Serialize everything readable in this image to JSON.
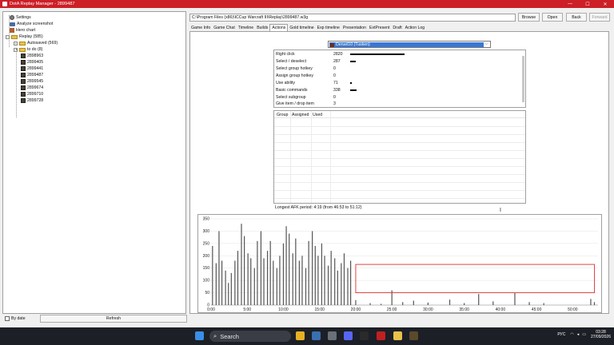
{
  "window": {
    "title": "DotA Replay Manager - 2899487",
    "minimize": "—",
    "maximize": "☐",
    "close": "✕"
  },
  "sidebar": {
    "items": [
      {
        "label": "Settings",
        "icon": "gear-icon"
      },
      {
        "label": "Analyze screenshot",
        "icon": "camera-icon"
      },
      {
        "label": "Hero chart",
        "icon": "hero-icon"
      },
      {
        "label": "Replay (585)",
        "icon": "folder-icon"
      },
      {
        "label": "Autosaved (569)",
        "icon": "folder-icon"
      },
      {
        "label": "to do (8)",
        "icon": "folder-icon"
      },
      {
        "label": "2898963",
        "icon": "replay-icon"
      },
      {
        "label": "2899405",
        "icon": "replay-icon"
      },
      {
        "label": "2899441",
        "icon": "replay-icon"
      },
      {
        "label": "2899487",
        "icon": "replay-icon"
      },
      {
        "label": "2899545",
        "icon": "replay-icon"
      },
      {
        "label": "2899674",
        "icon": "replay-icon"
      },
      {
        "label": "2899710",
        "icon": "replay-icon"
      },
      {
        "label": "2899728",
        "icon": "replay-icon"
      }
    ],
    "by_date": "By date",
    "refresh": "Refresh"
  },
  "path": {
    "value": "C:\\Program Files (x86)\\ICCup Warcraft III\\Replay\\2899487.w3g"
  },
  "toolbar": {
    "browse": "Browse",
    "open": "Open",
    "back": "Back",
    "forward": "Forward"
  },
  "tabs": [
    "Game Info",
    "Game Chat",
    "Timeline",
    "Builds",
    "Actions",
    "Gold timeline",
    "Exp timeline",
    "Presentation",
    "ExtPresent",
    "Draft",
    "Action Log"
  ],
  "active_tab": "Actions",
  "player": {
    "selected": "Deruel10 (Tusken)"
  },
  "actions": [
    {
      "name": "Right click",
      "value": "2820",
      "fraction": 1.0
    },
    {
      "name": "Select / deselect",
      "value": "287",
      "fraction": 0.1
    },
    {
      "name": "Select group hotkey",
      "value": "0",
      "fraction": 0
    },
    {
      "name": "Assign group hotkey",
      "value": "0",
      "fraction": 0
    },
    {
      "name": "Use ability",
      "value": "71",
      "fraction": 0.025
    },
    {
      "name": "Basic commands",
      "value": "338",
      "fraction": 0.12
    },
    {
      "name": "Select subgroup",
      "value": "0",
      "fraction": 0
    },
    {
      "name": "Give item / drop item",
      "value": "3",
      "fraction": 0
    }
  ],
  "groups": {
    "col_group": "Group",
    "col_assigned": "Assigned",
    "col_used": "Used"
  },
  "afk_text": "Longest AFK period: 4:19 (from 46:53 to 51:12)",
  "chart_data": {
    "type": "bar",
    "ylim": [
      0,
      350
    ],
    "yticks": [
      "350",
      "300",
      "250",
      "200",
      "150",
      "100",
      "50",
      "0"
    ],
    "xticks": [
      "0:00",
      "5:00",
      "10:00",
      "15:00",
      "20:00",
      "25:00",
      "30:00",
      "35:00",
      "40:00",
      "45:00",
      "50:00"
    ],
    "xmax_minutes": 53.5,
    "highlight": {
      "from_minutes": 20,
      "to_minutes": 53,
      "y_from": 50,
      "y_to": 165,
      "color": "#e03030"
    },
    "bar_color": "#555555",
    "points": [
      [
        0.2,
        240
      ],
      [
        0.7,
        170
      ],
      [
        1.1,
        300
      ],
      [
        1.5,
        180
      ],
      [
        2.0,
        140
      ],
      [
        2.4,
        90
      ],
      [
        2.8,
        130
      ],
      [
        3.3,
        180
      ],
      [
        3.7,
        220
      ],
      [
        4.2,
        330
      ],
      [
        4.6,
        280
      ],
      [
        5.1,
        210
      ],
      [
        5.5,
        190
      ],
      [
        6.0,
        150
      ],
      [
        6.4,
        260
      ],
      [
        6.9,
        300
      ],
      [
        7.3,
        190
      ],
      [
        7.8,
        220
      ],
      [
        8.2,
        260
      ],
      [
        8.6,
        180
      ],
      [
        9.1,
        150
      ],
      [
        9.5,
        200
      ],
      [
        10.0,
        250
      ],
      [
        10.4,
        320
      ],
      [
        10.8,
        290
      ],
      [
        11.3,
        210
      ],
      [
        11.7,
        270
      ],
      [
        12.2,
        180
      ],
      [
        12.6,
        200
      ],
      [
        13.1,
        150
      ],
      [
        13.5,
        260
      ],
      [
        14.0,
        300
      ],
      [
        14.4,
        240
      ],
      [
        14.8,
        200
      ],
      [
        15.3,
        250
      ],
      [
        15.7,
        200
      ],
      [
        16.2,
        160
      ],
      [
        16.6,
        220
      ],
      [
        17.1,
        190
      ],
      [
        17.5,
        140
      ],
      [
        18.0,
        170
      ],
      [
        18.4,
        210
      ],
      [
        18.9,
        150
      ],
      [
        19.3,
        180
      ],
      [
        20.0,
        20
      ],
      [
        22.0,
        8
      ],
      [
        23.5,
        5
      ],
      [
        25.0,
        60
      ],
      [
        26.5,
        12
      ],
      [
        28.0,
        18
      ],
      [
        30.0,
        10
      ],
      [
        33.0,
        22
      ],
      [
        35.0,
        8
      ],
      [
        37.0,
        45
      ],
      [
        39.0,
        15
      ],
      [
        42.0,
        50
      ],
      [
        44.0,
        12
      ],
      [
        46.0,
        8
      ],
      [
        52.5,
        25
      ],
      [
        53.0,
        12
      ]
    ]
  },
  "taskbar": {
    "search_placeholder": "Search",
    "lang": "РУС",
    "time": "03:28",
    "date": "27/09/2026"
  }
}
